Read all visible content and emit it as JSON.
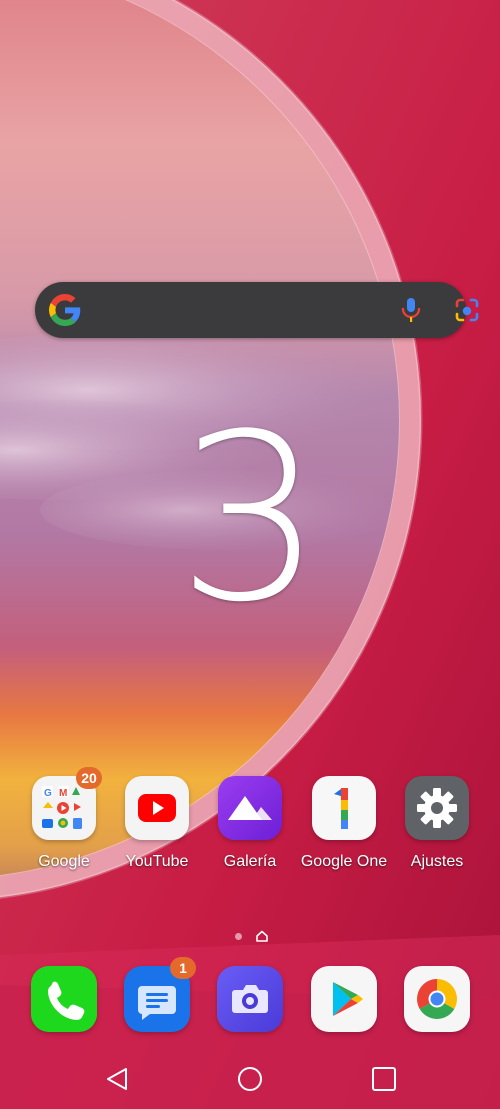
{
  "clock": {
    "text": "3"
  },
  "search": {
    "google_icon": "google-g-icon",
    "mic_icon": "microphone-icon",
    "lens_icon": "google-lens-icon"
  },
  "apps": [
    {
      "label": "Google",
      "icon": "google-folder-icon",
      "badge": "20"
    },
    {
      "label": "YouTube",
      "icon": "youtube-icon"
    },
    {
      "label": "Galería",
      "icon": "gallery-icon"
    },
    {
      "label": "Google One",
      "icon": "google-one-icon"
    },
    {
      "label": "Ajustes",
      "icon": "settings-gear-icon"
    }
  ],
  "dock": [
    {
      "name": "Phone",
      "icon": "phone-icon"
    },
    {
      "name": "Messages",
      "icon": "messages-icon",
      "badge": "1"
    },
    {
      "name": "Camera",
      "icon": "camera-icon"
    },
    {
      "name": "Play Store",
      "icon": "play-store-icon"
    },
    {
      "name": "Chrome",
      "icon": "chrome-icon"
    }
  ],
  "navigation": [
    "back-icon",
    "home-icon",
    "recents-icon"
  ],
  "colors": {
    "badge": "#e46a2c",
    "youtube_red": "#ff0000",
    "gallery_purple": "#8a2be2",
    "phone_green": "#1ed81e",
    "messages_blue": "#1a73e8",
    "camera_indigo": "#5a4cf0",
    "settings_gray": "#5f6368"
  }
}
